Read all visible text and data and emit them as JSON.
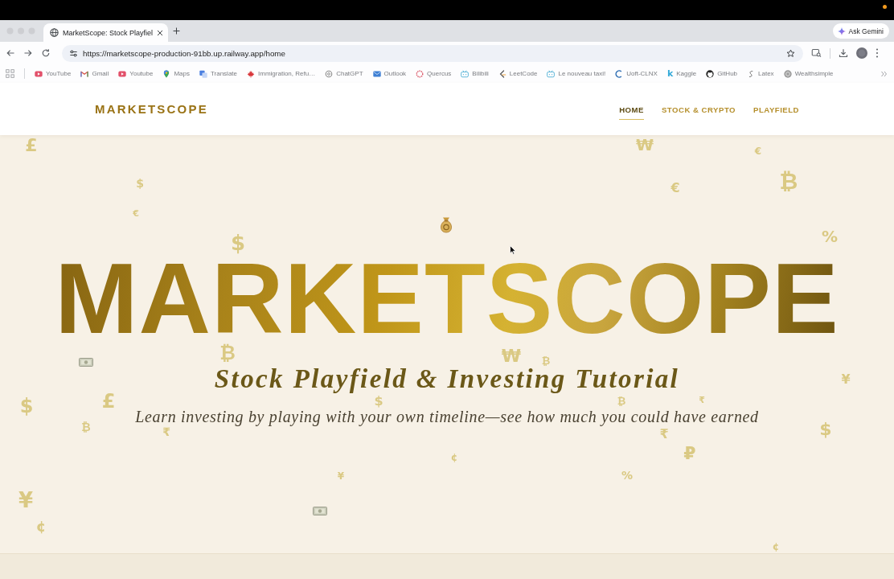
{
  "browser": {
    "tabs": [
      {
        "title": "MarketScope: Stock Playfiel",
        "selected": true
      }
    ],
    "gemini_button": "Ask Gemini",
    "address_bar": {
      "url": "https://marketscope-production-91bb.up.railway.app/home"
    },
    "bookmarks": [
      {
        "label": "YouTube"
      },
      {
        "label": "Gmail"
      },
      {
        "label": "Youtube"
      },
      {
        "label": "Maps"
      },
      {
        "label": "Translate"
      },
      {
        "label": "Immigration, Refu…"
      },
      {
        "label": "ChatGPT"
      },
      {
        "label": "Outlook"
      },
      {
        "label": "Quercus"
      },
      {
        "label": "Bilibili"
      },
      {
        "label": "LeetCode"
      },
      {
        "label": "Le nouveau taxi!"
      },
      {
        "label": "Uoft-CLNX"
      },
      {
        "label": "Kaggle",
        "icon_letter": "k"
      },
      {
        "label": "GitHub"
      },
      {
        "label": "Latex"
      },
      {
        "label": "Wealthsimple"
      }
    ]
  },
  "navbar": {
    "logo": "MARKETSCOPE",
    "links": [
      {
        "label": "HOME",
        "selected": true
      },
      {
        "label": "STOCK & CRYPTO",
        "selected": false
      },
      {
        "label": "PLAYFIELD",
        "selected": false
      }
    ]
  },
  "hero": {
    "title": "MARKETSCOPE",
    "subtitle": "Stock Playfield & Investing Tutorial",
    "tagline": "Learn investing by playing with your own timeline—see how much you could have earned",
    "floating_symbols": [
      "£",
      "₩",
      "€",
      "$",
      "€",
      "₿",
      "€",
      "$",
      "%",
      "₿",
      "₩",
      "₿",
      "¥",
      "$",
      "£",
      "$",
      "₿",
      "₹",
      "₿",
      "₹",
      "₹",
      "$",
      "¢",
      "₽",
      "¥",
      "%",
      "¥",
      "¢",
      "¢"
    ]
  }
}
